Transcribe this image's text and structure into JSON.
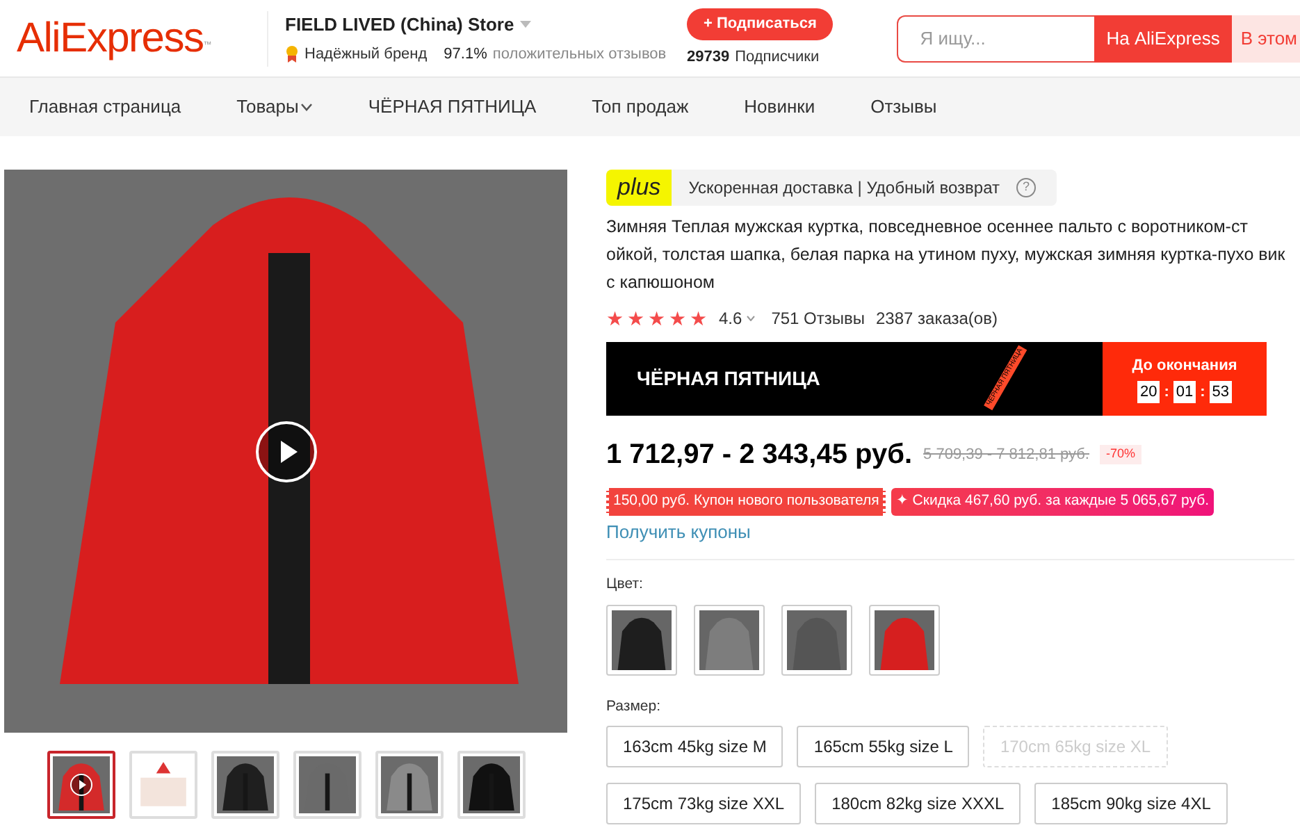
{
  "header": {
    "logo": "AliExpress",
    "logo_mark": "™",
    "store_name": "FIELD LIVED (China) Store",
    "badge": "Надёжный бренд",
    "rating": "97.1%",
    "rating_label": "положительных отзывов",
    "subscribe": "+ Подписаться",
    "followers": "29739",
    "followers_label": "Подписчики",
    "search_placeholder": "Я ищу...",
    "search_button": "На AliExpress",
    "search_button_2": "В этом"
  },
  "nav": [
    {
      "label": "Главная страница",
      "dropdown": false
    },
    {
      "label": "Товары",
      "dropdown": true
    },
    {
      "label": "ЧЁРНАЯ ПЯТНИЦА",
      "dropdown": false
    },
    {
      "label": "Топ продаж",
      "dropdown": false
    },
    {
      "label": "Новинки",
      "dropdown": false
    },
    {
      "label": "Отзывы",
      "dropdown": false
    }
  ],
  "gallery": {
    "thumbnails": [
      {
        "kind": "video",
        "color": "#d42a2a",
        "selected": true
      },
      {
        "kind": "chart",
        "color": "#f3e4dc",
        "selected": false
      },
      {
        "kind": "photo",
        "color": "#1f1f1f",
        "selected": false
      },
      {
        "kind": "photo",
        "color": "#6a6a6a",
        "selected": false
      },
      {
        "kind": "photo",
        "color": "#8a8a8a",
        "selected": false
      },
      {
        "kind": "photo",
        "color": "#111111",
        "selected": false
      }
    ]
  },
  "product": {
    "plus": "plus",
    "plus_text": "Ускоренная доставка | Удобный возврат",
    "help": "?",
    "title": "Зимняя Теплая мужская куртка, повседневное осеннее пальто с воротником-ст ойкой, толстая шапка, белая парка на утином пуху, мужская зимняя куртка-пухо вик с капюшоном",
    "stars": 5,
    "score": "4.6",
    "reviews": "751 Отзывы",
    "orders": "2387 заказа(ов)",
    "promo": {
      "title": "ЧЁРНАЯ ПЯТНИЦА",
      "ribbon": "ЧЁРНАЯ ПЯТНИЦА",
      "countdown_label": "До окончания",
      "hours": "20",
      "minutes": "01",
      "seconds": "53",
      "separator": ":"
    },
    "price": "1 712,97 - 2 343,45 руб.",
    "old_price": "5 709,39 - 7 812,81 руб.",
    "discount": "-70%",
    "coupons": [
      {
        "kind": "coupon",
        "text": "150,00 руб. Купон нового пользователя"
      },
      {
        "kind": "deal",
        "text": "✦ Скидка 467,60 руб. за каждые 5 065,67 руб."
      }
    ],
    "get_coupons": "Получить купоны",
    "color_label": "Цвет:",
    "colors": [
      {
        "color": "#1e1e1e"
      },
      {
        "color": "#7d7d7d"
      },
      {
        "color": "#555555"
      },
      {
        "color": "#d61f1f"
      }
    ],
    "size_label": "Размер:",
    "sizes": [
      {
        "label": "163cm 45kg size M",
        "disabled": false
      },
      {
        "label": "165cm 55kg size L",
        "disabled": false
      },
      {
        "label": "170cm 65kg size XL",
        "disabled": true
      },
      {
        "label": "175cm 73kg size XXL",
        "disabled": false
      },
      {
        "label": "180cm 82kg size XXXL",
        "disabled": false
      },
      {
        "label": "185cm 90kg size 4XL",
        "disabled": false
      }
    ]
  }
}
